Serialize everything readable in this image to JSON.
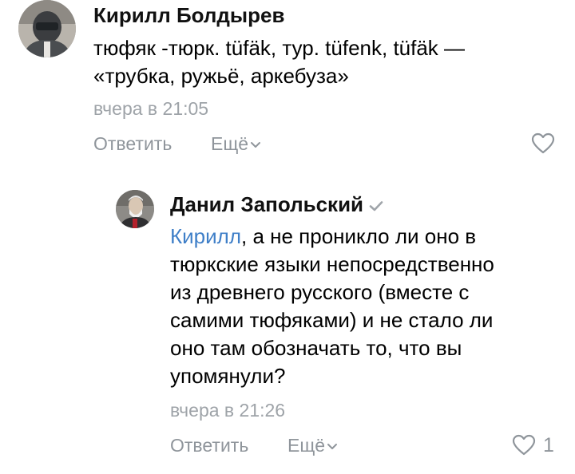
{
  "comment": {
    "author": "Кирилл Болдырев",
    "text": "тюфяк -тюрк. tüfäk, тур. tüfenk, tüfäk —\n«трубка, ружьё, аркебуза»",
    "time": "вчера в 21:05",
    "reply_label": "Ответить",
    "more_label": "Ещё",
    "avatar_icon": "user-avatar-icon",
    "like_icon": "heart-outline-icon"
  },
  "reply": {
    "author": "Данил Запольский",
    "mention": "Кирилл",
    "text": ", а не проникло ли оно в\nтюркские языки непосредственно\nиз древнего русского (вместе с\nсамими тюфяками) и не стало ли\nоно там обозначать то, что вы\nупомянули?",
    "time": "вчера в 21:26",
    "reply_label": "Ответить",
    "more_label": "Ещё",
    "like_count": "1",
    "verified_icon": "checkmark-icon",
    "like_icon": "heart-outline-icon"
  },
  "colors": {
    "link": "#3f7fc8",
    "muted": "#8f959b",
    "time": "#9ea3a8"
  }
}
